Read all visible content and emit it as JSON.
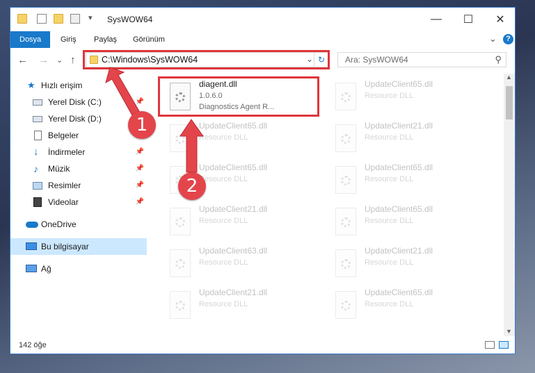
{
  "titlebar": {
    "title": "SysWOW64",
    "minimize_glyph": "—",
    "maximize_glyph": "☐",
    "close_glyph": "✕"
  },
  "ribbon": {
    "tabs": [
      "Dosya",
      "Giriş",
      "Paylaş",
      "Görünüm"
    ],
    "expand_glyph": "⌄",
    "help_glyph": "?"
  },
  "navbar": {
    "back_glyph": "←",
    "forward_glyph": "→",
    "recent_glyph": "⌄",
    "up_glyph": "↑",
    "address": "C:\\Windows\\SysWOW64",
    "address_dropdown_glyph": "⌄",
    "refresh_glyph": "↻",
    "search_placeholder": "Ara: SysWOW64",
    "search_glyph": "⚲"
  },
  "sidebar": {
    "items": [
      {
        "label": "Hızlı erişim",
        "icon": "star-icon",
        "pinned": false
      },
      {
        "label": "Yerel Disk (C:)",
        "icon": "drive-icon",
        "pinned": true
      },
      {
        "label": "Yerel Disk (D:)",
        "icon": "drive-icon",
        "pinned": false
      },
      {
        "label": "Belgeler",
        "icon": "documents-icon",
        "pinned": true
      },
      {
        "label": "İndirmeler",
        "icon": "download-icon",
        "pinned": true
      },
      {
        "label": "Müzik",
        "icon": "music-icon",
        "pinned": true
      },
      {
        "label": "Resimler",
        "icon": "pictures-icon",
        "pinned": true
      },
      {
        "label": "Videolar",
        "icon": "video-icon",
        "pinned": true
      },
      {
        "label": "OneDrive",
        "icon": "cloud-icon",
        "pinned": false
      },
      {
        "label": "Bu bilgisayar",
        "icon": "computer-icon",
        "pinned": false
      },
      {
        "label": "Ağ",
        "icon": "network-icon",
        "pinned": false
      }
    ],
    "pin_glyph": "📌"
  },
  "files": {
    "highlighted": {
      "name": "diagent.dll",
      "version": "1.0.6.0",
      "description": "Diagnostics Agent R..."
    },
    "background": [
      {
        "name": "UpdateClient65.dll",
        "desc": "Resource DLL"
      },
      {
        "name": "UpdateClient65.dll",
        "desc": "Resource DLL"
      },
      {
        "name": "UpdateClient21.dll",
        "desc": "Resource DLL"
      },
      {
        "name": "UpdateClient65.dll",
        "desc": "Resource DLL"
      },
      {
        "name": "UpdateClient65.dll",
        "desc": "Resource DLL"
      },
      {
        "name": "UpdateClient65.dll",
        "desc": "Resource DLL"
      },
      {
        "name": "UpdateClient21.dll",
        "desc": "Resource DLL"
      },
      {
        "name": "UpdateClient65.dll",
        "desc": "Resource DLL"
      },
      {
        "name": "UpdateClient63.dll",
        "desc": "Resource DLL"
      },
      {
        "name": "UpdateClient21.dll",
        "desc": "Resource DLL"
      },
      {
        "name": "UpdateClient21.dll",
        "desc": "Resource DLL"
      },
      {
        "name": "UpdateClient65.dll",
        "desc": "Resource DLL"
      }
    ]
  },
  "status": {
    "count": "142 öğe"
  },
  "annotations": {
    "badge1": "1",
    "badge2": "2",
    "color": "#e0353b"
  }
}
